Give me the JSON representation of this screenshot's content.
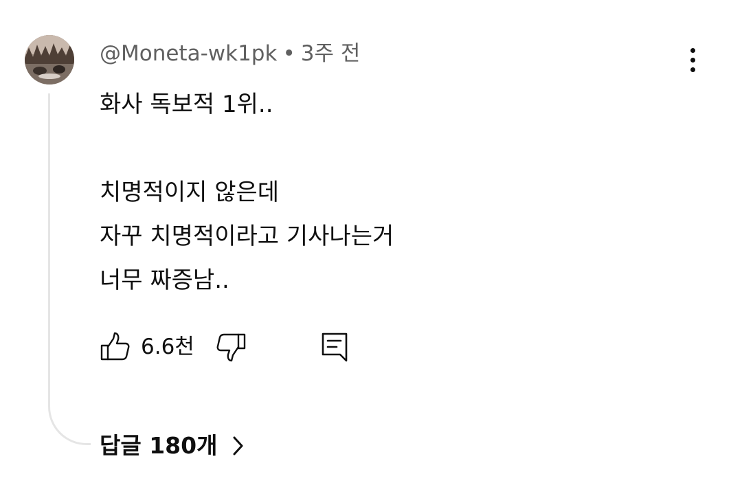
{
  "comment": {
    "author": "@Moneta-wk1pk",
    "separator": "•",
    "time": "3주 전",
    "text_lines": [
      "화사 독보적 1위..",
      "",
      "치명적이지 않은데",
      "자꾸 치명적이라고 기사나는거",
      "너무 짜증남.."
    ],
    "like_count": "6.6천",
    "replies_label": "답글 180개"
  },
  "icons": {
    "more": "more-vertical-icon",
    "like": "thumbs-up-icon",
    "dislike": "thumbs-down-icon",
    "reply": "reply-comment-icon",
    "replies": "chevron-right-icon"
  },
  "colors": {
    "text": "#0f0f0f",
    "secondary_text": "#606060",
    "thread_line": "#e5e5e5"
  }
}
